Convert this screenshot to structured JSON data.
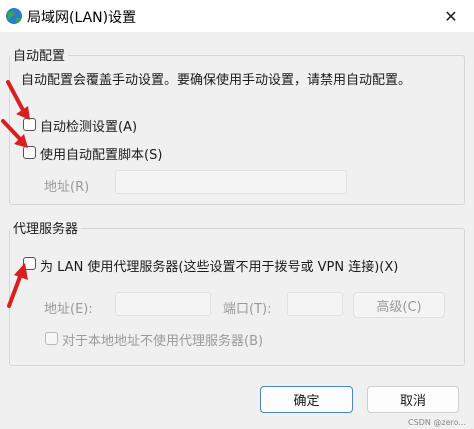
{
  "window": {
    "title": "局域网(LAN)设置",
    "icon": "globe-network-icon",
    "close_glyph": "✕"
  },
  "auto_config": {
    "group_title": "自动配置",
    "description": "自动配置会覆盖手动设置。要确保使用手动设置，请禁用自动配置。",
    "auto_detect_label": "自动检测设置(A)",
    "auto_detect_checked": false,
    "use_script_label": "使用自动配置脚本(S)",
    "use_script_checked": false,
    "address_label": "地址(R)",
    "address_value": ""
  },
  "proxy": {
    "group_title": "代理服务器",
    "use_proxy_label": "为 LAN 使用代理服务器(这些设置不用于拨号或 VPN 连接)(X)",
    "use_proxy_checked": false,
    "address_label": "地址(E):",
    "address_value": "",
    "port_label": "端口(T):",
    "port_value": "",
    "advanced_label": "高级(C)",
    "bypass_local_label": "对于本地地址不使用代理服务器(B)",
    "bypass_local_checked": false
  },
  "footer": {
    "ok_label": "确定",
    "cancel_label": "取消"
  },
  "watermark": "CSDN @zero...",
  "colors": {
    "annotation_arrow": "#d92020",
    "default_button_border": "#4a86c8",
    "icon_blue": "#2b7bd3",
    "icon_green": "#3aa845"
  }
}
